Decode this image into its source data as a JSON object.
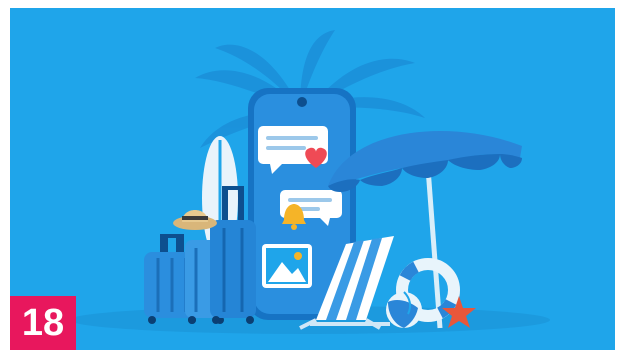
{
  "badge": {
    "number": "18"
  },
  "colors": {
    "background": "#1fa5ea",
    "badge": "#e8175d",
    "phone": "#2a8fdf",
    "heart": "#ef4a55",
    "bell": "#f5b428",
    "starfish": "#e8573b"
  },
  "icons": [
    "palm-leaves-icon",
    "surfboard-icon",
    "phone-icon",
    "chat-bubble-icon",
    "heart-icon",
    "bell-icon",
    "image-icon",
    "suitcase-icon",
    "hat-icon",
    "beach-umbrella-icon",
    "beach-chair-icon",
    "life-ring-icon",
    "beach-ball-icon",
    "starfish-icon"
  ]
}
